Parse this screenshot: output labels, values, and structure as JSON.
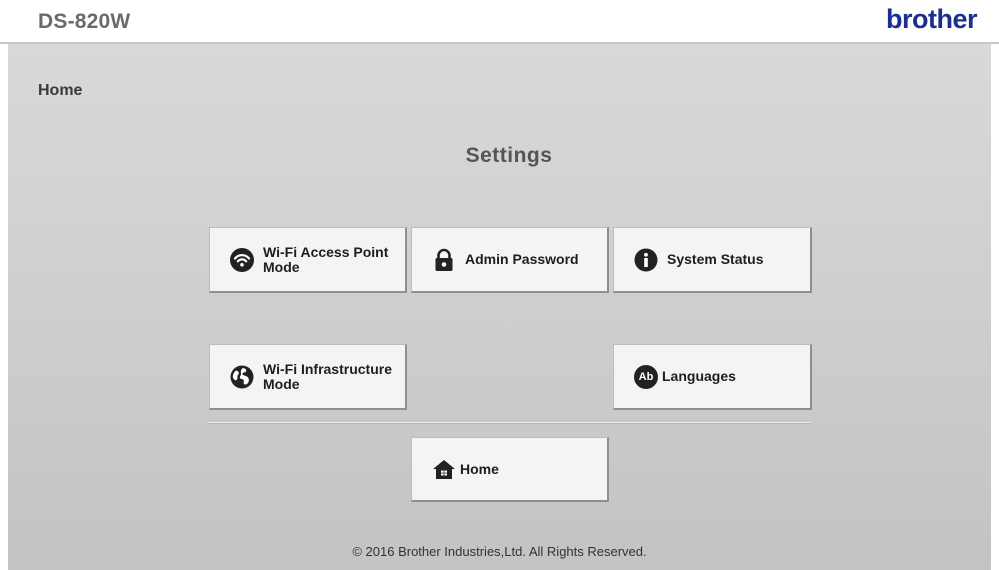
{
  "header": {
    "model": "DS-820W",
    "brand": "brother"
  },
  "breadcrumb": "Home",
  "page_title": "Settings",
  "buttons": {
    "wifi_ap": {
      "label": "Wi-Fi Access Point Mode",
      "icon": "wifi-icon"
    },
    "admin_password": {
      "label": "Admin Password",
      "icon": "lock-icon"
    },
    "system_status": {
      "label": "System Status",
      "icon": "info-icon"
    },
    "wifi_infra": {
      "label": "Wi-Fi Infrastructure Mode",
      "icon": "globe-icon"
    },
    "languages": {
      "label": "Languages",
      "icon": "languages-icon",
      "icon_text": "Ab"
    },
    "home": {
      "label": "Home",
      "icon": "home-icon"
    }
  },
  "footer": "© 2016 Brother Industries,Ltd. All Rights Reserved.",
  "colors": {
    "brand": "#1b2f8f",
    "button_bg": "#f4f4f4",
    "content_bg": "#d4d4d4"
  }
}
